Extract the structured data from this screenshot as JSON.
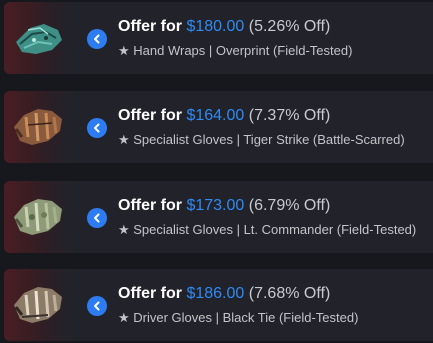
{
  "offer_prefix": "Offer for",
  "offers": [
    {
      "price": "$180.00",
      "discount": "(5.26% Off)",
      "item": "★ Hand Wraps | Overprint (Field-Tested)",
      "thumb_color": "#3e8f86",
      "icon": "hand-wraps-icon"
    },
    {
      "price": "$164.00",
      "discount": "(7.37% Off)",
      "item": "★ Specialist Gloves | Tiger Strike (Battle-Scarred)",
      "thumb_color": "#8a5a3c",
      "icon": "specialist-gloves-icon"
    },
    {
      "price": "$173.00",
      "discount": "(6.79% Off)",
      "item": "★ Specialist Gloves | Lt. Commander (Field-Tested)",
      "thumb_color": "#8e9a78",
      "icon": "specialist-gloves-icon"
    },
    {
      "price": "$186.00",
      "discount": "(7.68% Off)",
      "item": "★ Driver Gloves | Black Tie (Field-Tested)",
      "thumb_color": "#8c7b67",
      "icon": "driver-gloves-icon"
    }
  ],
  "colors": {
    "accent": "#2e8af5",
    "button": "#2d7cf2",
    "card_bg": "#22232a",
    "page_bg": "#17181d"
  }
}
